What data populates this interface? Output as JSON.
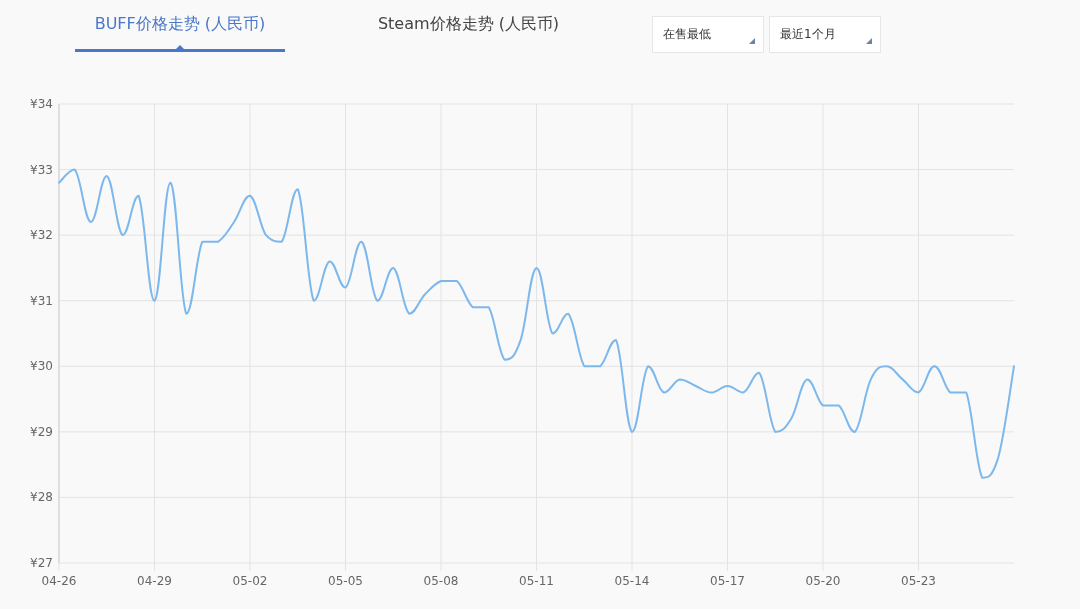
{
  "tabs": [
    {
      "label": "BUFF价格走势 (人民币)",
      "selected": true
    },
    {
      "label": "Steam价格走势 (人民币)",
      "selected": false
    }
  ],
  "dropdowns": [
    {
      "value": "在售最低"
    },
    {
      "value": "最近1个月"
    }
  ],
  "chart_data": {
    "type": "line",
    "grid": true,
    "ylim": [
      27,
      34
    ],
    "categories": [
      "04-26",
      null,
      null,
      null,
      null,
      null,
      "04-29",
      null,
      null,
      null,
      null,
      null,
      "05-02",
      null,
      null,
      null,
      null,
      null,
      "05-05",
      null,
      null,
      null,
      null,
      null,
      "05-08",
      null,
      null,
      null,
      null,
      null,
      "05-11",
      null,
      null,
      null,
      null,
      null,
      "05-14",
      null,
      null,
      null,
      null,
      null,
      "05-17",
      null,
      null,
      null,
      null,
      null,
      "05-20",
      null,
      null,
      null,
      null,
      null,
      "05-23",
      null,
      null,
      null,
      null,
      null,
      null
    ],
    "series": [
      {
        "color": "#7db8ec",
        "values": [
          32.8,
          33.0,
          32.2,
          32.9,
          32.0,
          32.6,
          31.0,
          32.8,
          30.8,
          31.9,
          31.9,
          32.2,
          32.6,
          32.0,
          31.9,
          32.7,
          31.0,
          31.6,
          31.2,
          31.9,
          31.0,
          31.5,
          30.8,
          31.1,
          31.3,
          31.3,
          30.9,
          30.9,
          30.1,
          30.4,
          31.5,
          30.5,
          30.8,
          30.0,
          30.0,
          30.4,
          29.0,
          30.0,
          29.6,
          29.8,
          29.7,
          29.6,
          29.7,
          29.6,
          29.9,
          29.0,
          29.2,
          29.8,
          29.4,
          29.4,
          29.0,
          29.8,
          30.0,
          29.8,
          29.6,
          30.0,
          29.6,
          29.6,
          28.3,
          28.6,
          30.0
        ]
      }
    ],
    "yticks": [
      {
        "value": 27,
        "label": "¥27"
      },
      {
        "value": 28,
        "label": "¥28"
      },
      {
        "value": 29,
        "label": "¥29"
      },
      {
        "value": 30,
        "label": "¥30"
      },
      {
        "value": 31,
        "label": "¥31"
      },
      {
        "value": 32,
        "label": "¥32"
      },
      {
        "value": 33,
        "label": "¥33"
      },
      {
        "value": 34,
        "label": "¥34"
      }
    ]
  }
}
